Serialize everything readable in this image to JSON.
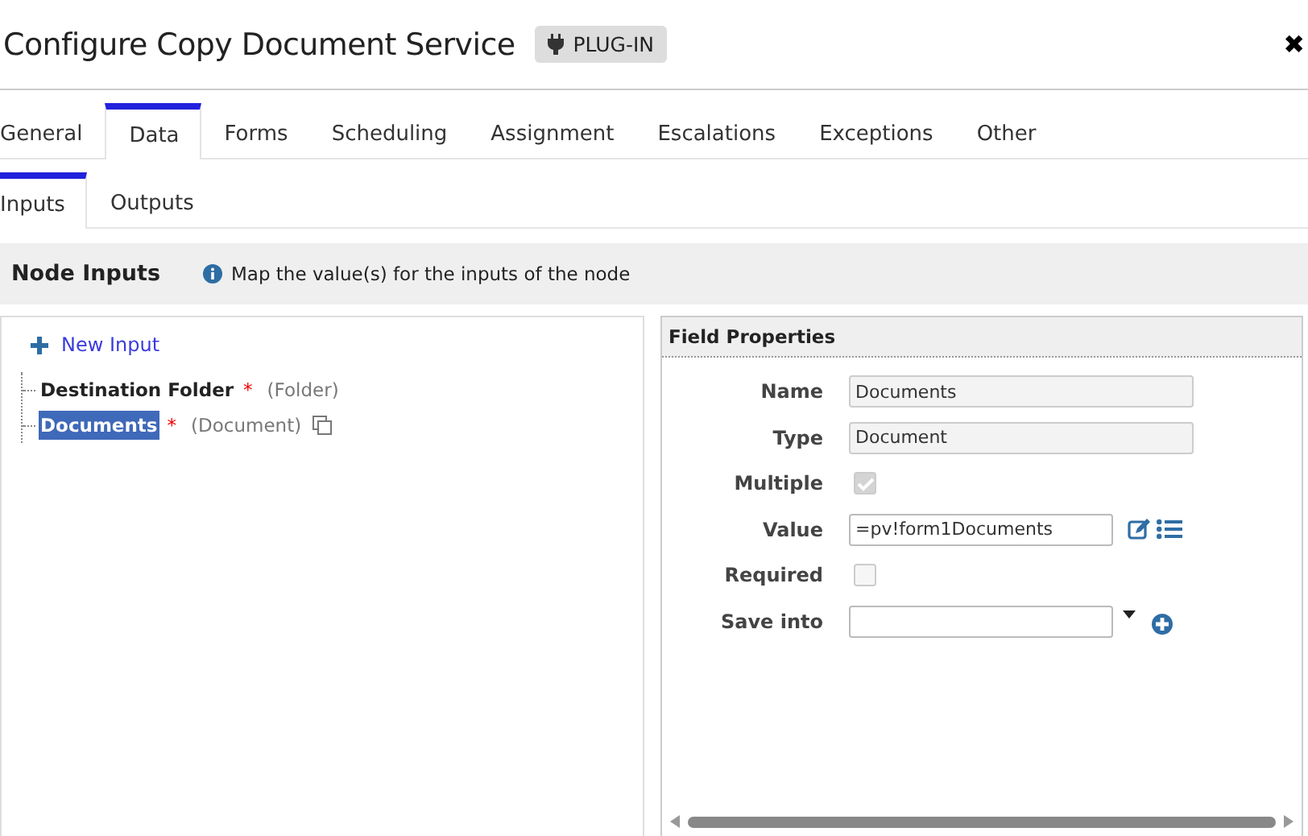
{
  "window": {
    "title": "Configure Copy Document Service",
    "badge": "PLUG-IN",
    "close": "✖"
  },
  "tabs": [
    {
      "label": "General",
      "selected": false
    },
    {
      "label": "Data",
      "selected": true
    },
    {
      "label": "Forms",
      "selected": false
    },
    {
      "label": "Scheduling",
      "selected": false
    },
    {
      "label": "Assignment",
      "selected": false
    },
    {
      "label": "Escalations",
      "selected": false
    },
    {
      "label": "Exceptions",
      "selected": false
    },
    {
      "label": "Other",
      "selected": false
    }
  ],
  "subtabs": [
    {
      "label": "Inputs",
      "selected": true
    },
    {
      "label": "Outputs",
      "selected": false
    }
  ],
  "section": {
    "title": "Node Inputs",
    "info": "Map the value(s) for the inputs of the node"
  },
  "inputs": {
    "new_input": "New Input",
    "items": [
      {
        "name": "Destination Folder",
        "required": "*",
        "type": "(Folder)",
        "selected": false,
        "multiple": false
      },
      {
        "name": "Documents",
        "required": "*",
        "type": "(Document)",
        "selected": true,
        "multiple": true
      }
    ]
  },
  "field_properties": {
    "title": "Field Properties",
    "rows": [
      {
        "kind": "text",
        "label": "Name",
        "value": "Documents"
      },
      {
        "kind": "text",
        "label": "Type",
        "value": "Document"
      },
      {
        "kind": "checkbox",
        "label": "Multiple",
        "checked": true
      },
      {
        "kind": "value",
        "label": "Value",
        "value": "=pv!form1Documents"
      },
      {
        "kind": "checkbox",
        "label": "Required",
        "checked": false
      },
      {
        "kind": "select",
        "label": "Save into"
      }
    ]
  }
}
